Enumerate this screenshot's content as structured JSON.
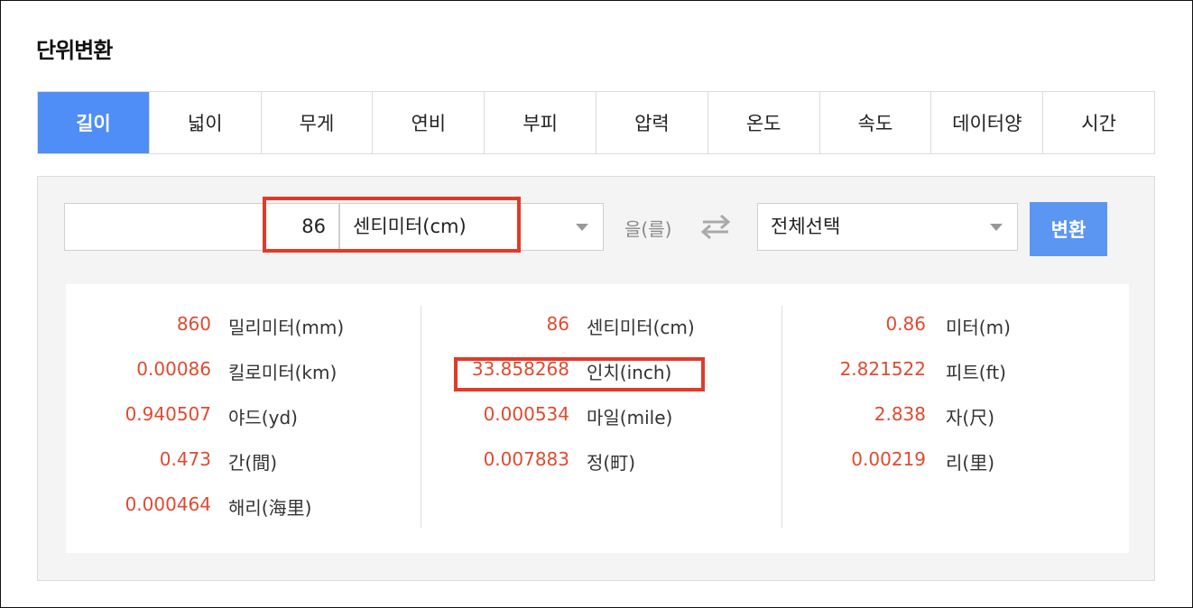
{
  "title": "단위변환",
  "tabs": [
    "길이",
    "넓이",
    "무게",
    "연비",
    "부피",
    "압력",
    "온도",
    "속도",
    "데이터양",
    "시간"
  ],
  "active_tab": "길이",
  "converter": {
    "input_value": "86",
    "from_unit": "센티미터(cm)",
    "particle": "을(를)",
    "to_unit": "전체선택",
    "convert_button": "변환"
  },
  "results": {
    "col1": [
      {
        "value": "860",
        "unit": "밀리미터(mm)"
      },
      {
        "value": "0.00086",
        "unit": "킬로미터(km)"
      },
      {
        "value": "0.940507",
        "unit": "야드(yd)"
      },
      {
        "value": "0.473",
        "unit": "간(間)"
      },
      {
        "value": "0.000464",
        "unit": "해리(海里)"
      }
    ],
    "col2": [
      {
        "value": "86",
        "unit": "센티미터(cm)"
      },
      {
        "value": "33.858268",
        "unit": "인치(inch)"
      },
      {
        "value": "0.000534",
        "unit": "마일(mile)"
      },
      {
        "value": "0.007883",
        "unit": "정(町)"
      }
    ],
    "col3": [
      {
        "value": "0.86",
        "unit": "미터(m)"
      },
      {
        "value": "2.821522",
        "unit": "피트(ft)"
      },
      {
        "value": "2.838",
        "unit": "자(尺)"
      },
      {
        "value": "0.00219",
        "unit": "리(里)"
      }
    ]
  },
  "colors": {
    "accent": "#4f8ef7",
    "value": "#e04a30",
    "highlight": "#e23a28"
  }
}
